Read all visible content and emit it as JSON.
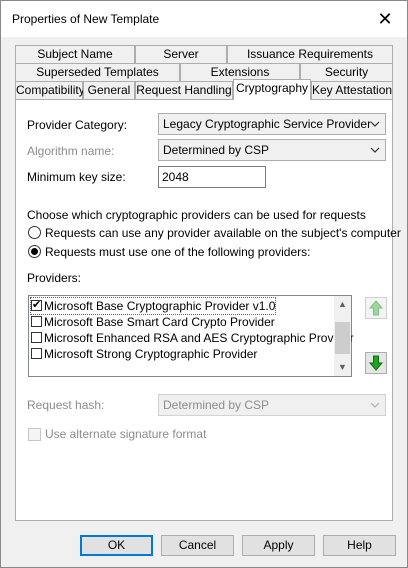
{
  "window": {
    "title": "Properties of New Template",
    "close_glyph": "✕"
  },
  "tabs": {
    "row1": [
      "Subject Name",
      "Server",
      "Issuance Requirements"
    ],
    "row2": [
      "Superseded Templates",
      "Extensions",
      "Security"
    ],
    "row3": [
      "Compatibility",
      "General",
      "Request Handling",
      "Cryptography",
      "Key Attestation"
    ],
    "active": "Cryptography"
  },
  "crypto": {
    "provider_category_label": "Provider Category:",
    "provider_category_value": "Legacy Cryptographic Service Provider",
    "algorithm_name_label": "Algorithm name:",
    "algorithm_name_value": "Determined by CSP",
    "min_key_size_label": "Minimum key size:",
    "min_key_size_value": "2048",
    "choose_text": "Choose which cryptographic providers can be used for requests",
    "radio_any_label": "Requests can use any provider available on the subject's computer",
    "radio_must_label": "Requests must use one of the following providers:",
    "providers_label": "Providers:",
    "providers": [
      {
        "label": "Microsoft Base Cryptographic Provider v1.0",
        "checked": true
      },
      {
        "label": "Microsoft Base Smart Card Crypto Provider",
        "checked": false
      },
      {
        "label": "Microsoft Enhanced RSA and AES Cryptographic Provider",
        "checked": false
      },
      {
        "label": "Microsoft Strong Cryptographic Provider",
        "checked": false
      }
    ],
    "request_hash_label": "Request hash:",
    "request_hash_value": "Determined by CSP",
    "alt_signature_label": "Use alternate signature format"
  },
  "buttons": {
    "ok": "OK",
    "cancel": "Cancel",
    "apply": "Apply",
    "help": "Help"
  },
  "colors": {
    "accent": "#0078d7",
    "move_up_arrow": "#9fd89f",
    "move_down_arrow": "#1ea51e"
  }
}
